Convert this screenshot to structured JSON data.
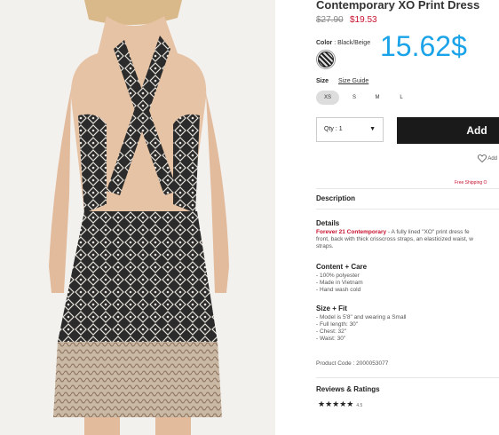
{
  "product": {
    "title": "Contemporary XO Print Dress",
    "original_price": "$27.90",
    "sale_price": "$19.53"
  },
  "overlay_price": "15.62$",
  "color": {
    "label": "Color",
    "value": " : Black/Beige"
  },
  "size": {
    "label": "Size",
    "guide_label": "Size Guide",
    "options": [
      "XS",
      "S",
      "M",
      "L"
    ],
    "selected": "XS"
  },
  "quantity": {
    "label": "Qty : 1"
  },
  "add_button": "Add",
  "wishlist": "Add",
  "free_shipping": "Free Shipping O",
  "description_heading": "Description",
  "details": {
    "heading": "Details",
    "brand": "Forever 21 Contemporary",
    "line1": " - A fully lined \"XO\" print dress fe",
    "line2": "front, back with thick crisscross straps, an elasticized waist, w",
    "line3": "straps."
  },
  "content_care": {
    "heading": "Content + Care",
    "items": [
      "- 100% polyester",
      "- Made in Vietnam",
      "- Hand wash cold"
    ]
  },
  "size_fit": {
    "heading": "Size + Fit",
    "items": [
      "- Model is 5'8\" and wearing a Small",
      "- Full length: 30\"",
      "- Chest: 32\"",
      "- Waist: 30\""
    ]
  },
  "product_code": "Product Code : 2000053077",
  "reviews": {
    "heading": "Reviews & Ratings",
    "stars": "★★★★★",
    "rating": "4.5"
  },
  "colors": {
    "accent_price": "#1aa3e8",
    "sale_red": "#c8102e",
    "button_black": "#1a1a1a"
  }
}
